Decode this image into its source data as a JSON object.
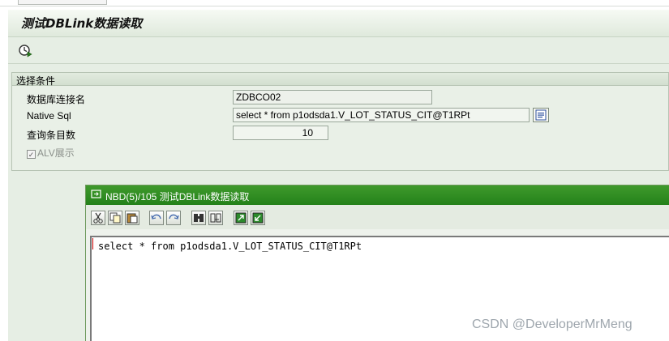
{
  "window": {
    "title": "测试DBLink数据读取"
  },
  "toolbar": {
    "execute_icon": "execute-clock-icon"
  },
  "selection": {
    "group_title": "选择条件",
    "fields": [
      {
        "label": "数据库连接名",
        "value": "ZDBCO02"
      },
      {
        "label": "Native Sql",
        "value": "select * from p1odsda1.V_LOT_STATUS_CIT@T1RPt"
      },
      {
        "label": "查询条目数",
        "value": "10"
      }
    ],
    "alv_checkbox": {
      "label": "ALV展示",
      "checked": true
    }
  },
  "dialog": {
    "title": "NBD(5)/105 测试DBLink数据读取",
    "toolbar_icons": [
      "cut-icon",
      "copy-icon",
      "paste-icon",
      "undo-icon",
      "redo-icon",
      "find-icon",
      "find-next-icon",
      "import-icon",
      "export-icon"
    ],
    "editor_text": "select * from p1odsda1.V_LOT_STATUS_CIT@T1RPt"
  },
  "watermark": "CSDN @DeveloperMrMeng",
  "colors": {
    "dialog_title_bg": "#2f8d22",
    "screen_bg": "#e6eee4"
  }
}
